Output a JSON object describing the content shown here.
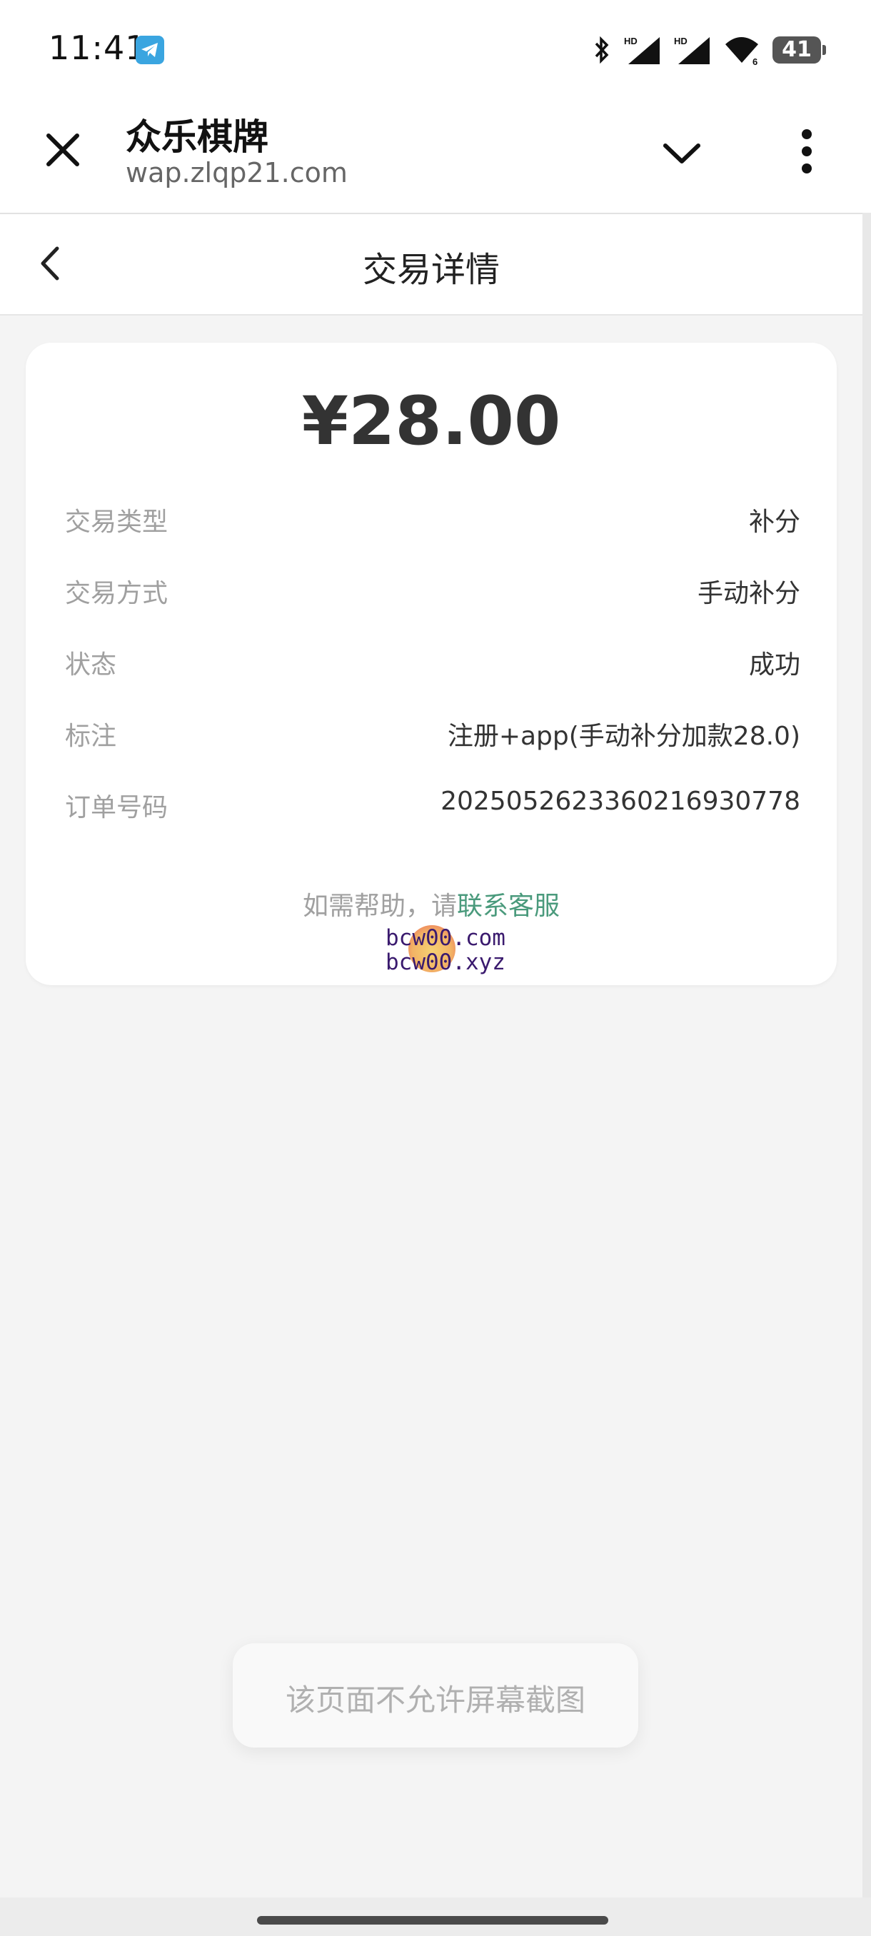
{
  "status_bar": {
    "time": "11:41",
    "notification_icon": "telegram-icon",
    "icons": [
      "bluetooth-icon",
      "hd-signal-icon",
      "hd-signal-icon",
      "wifi-icon"
    ],
    "battery_level": "41"
  },
  "browser": {
    "title": "众乐棋牌",
    "url": "wap.zlqp21.com",
    "close_icon": "close-icon",
    "dropdown_icon": "chevron-down-icon",
    "menu_icon": "more-vertical-icon"
  },
  "page": {
    "title": "交易详情",
    "back_icon": "chevron-left-icon"
  },
  "transaction": {
    "amount": "¥28.00",
    "rows": [
      {
        "label": "交易类型",
        "value": "补分"
      },
      {
        "label": "交易方式",
        "value": "手动补分"
      },
      {
        "label": "状态",
        "value": "成功"
      },
      {
        "label": "标注",
        "value": "注册+app(手动补分加款28.0)"
      },
      {
        "label": "订单号码",
        "value": "2025052623360216930778"
      }
    ],
    "help_prefix": "如需帮助，请",
    "help_link": "联系客服",
    "help_link_color": "#4a9a7c"
  },
  "watermark": {
    "line1": "bcw00.com",
    "line2": "bcw00.xyz"
  },
  "toast": {
    "message": "该页面不允许屏幕截图"
  }
}
